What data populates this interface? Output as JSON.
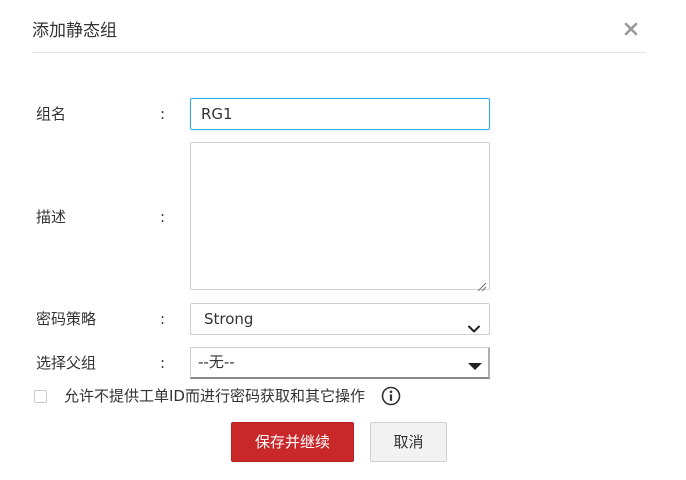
{
  "dialog": {
    "title": "添加静态组",
    "close_icon": "close-icon"
  },
  "form": {
    "group_name": {
      "label": "组名",
      "colon": ":",
      "value": "RG1"
    },
    "description": {
      "label": "描述",
      "colon": ":",
      "value": ""
    },
    "password_policy": {
      "label": "密码策略",
      "colon": ":",
      "value": "Strong"
    },
    "parent_group": {
      "label": "选择父组",
      "colon": ":",
      "value": "--无--"
    },
    "allow_without_ticket": {
      "label": "允许不提供工单ID而进行密码获取和其它操作",
      "checked": false,
      "info_icon": "info-icon"
    }
  },
  "buttons": {
    "save_continue": "保存并继续",
    "cancel": "取消"
  },
  "colors": {
    "primary": "#c9282b",
    "focus_border": "#35aee0",
    "default_button_bg": "#f2f2f2"
  }
}
